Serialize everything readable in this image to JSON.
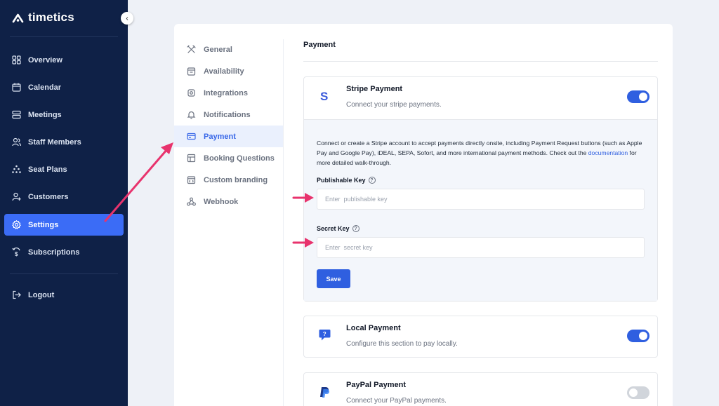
{
  "app": {
    "brand": "timetics"
  },
  "sidebar": {
    "items": [
      {
        "label": "Overview",
        "icon": "grid-icon"
      },
      {
        "label": "Calendar",
        "icon": "calendar-icon"
      },
      {
        "label": "Meetings",
        "icon": "stack-icon"
      },
      {
        "label": "Staff Members",
        "icon": "users-icon"
      },
      {
        "label": "Seat Plans",
        "icon": "seat-icon"
      },
      {
        "label": "Customers",
        "icon": "customer-icon"
      },
      {
        "label": "Settings",
        "icon": "gear-icon",
        "active": true
      },
      {
        "label": "Subscriptions",
        "icon": "dollar-icon"
      }
    ],
    "logout": "Logout"
  },
  "settings_nav": {
    "items": [
      {
        "label": "General",
        "icon": "tools-icon"
      },
      {
        "label": "Availability",
        "icon": "calendar-icon"
      },
      {
        "label": "Integrations",
        "icon": "chip-icon"
      },
      {
        "label": "Notifications",
        "icon": "bell-icon"
      },
      {
        "label": "Payment",
        "icon": "card-icon",
        "active": true
      },
      {
        "label": "Booking Questions",
        "icon": "table-icon"
      },
      {
        "label": "Custom branding",
        "icon": "brand-icon"
      },
      {
        "label": "Webhook",
        "icon": "webhook-icon"
      }
    ]
  },
  "main": {
    "title": "Payment",
    "stripe": {
      "name": "Stripe Payment",
      "desc": "Connect your stripe payments.",
      "enabled": true,
      "info_before": "Connect or create a Stripe account to accept payments directly onsite, including Payment Request buttons (such as Apple Pay and Google Pay), iDEAL, SEPA, Sofort, and more international payment methods. Check out the ",
      "info_link": "documentation",
      "info_after": " for more detailed walk-through.",
      "publishable_label": "Publishable Key",
      "publishable_placeholder": "Enter  publishable key",
      "secret_label": "Secret Key",
      "secret_placeholder": "Enter  secret key",
      "save": "Save"
    },
    "local": {
      "name": "Local Payment",
      "desc": "Configure this section to pay locally.",
      "enabled": true
    },
    "paypal": {
      "name": "PayPal Payment",
      "desc": "Connect your PayPal payments.",
      "enabled": false
    }
  },
  "colors": {
    "sidebar": "#0f2147",
    "accent": "#3b6cf6",
    "arrow": "#e8336d"
  }
}
